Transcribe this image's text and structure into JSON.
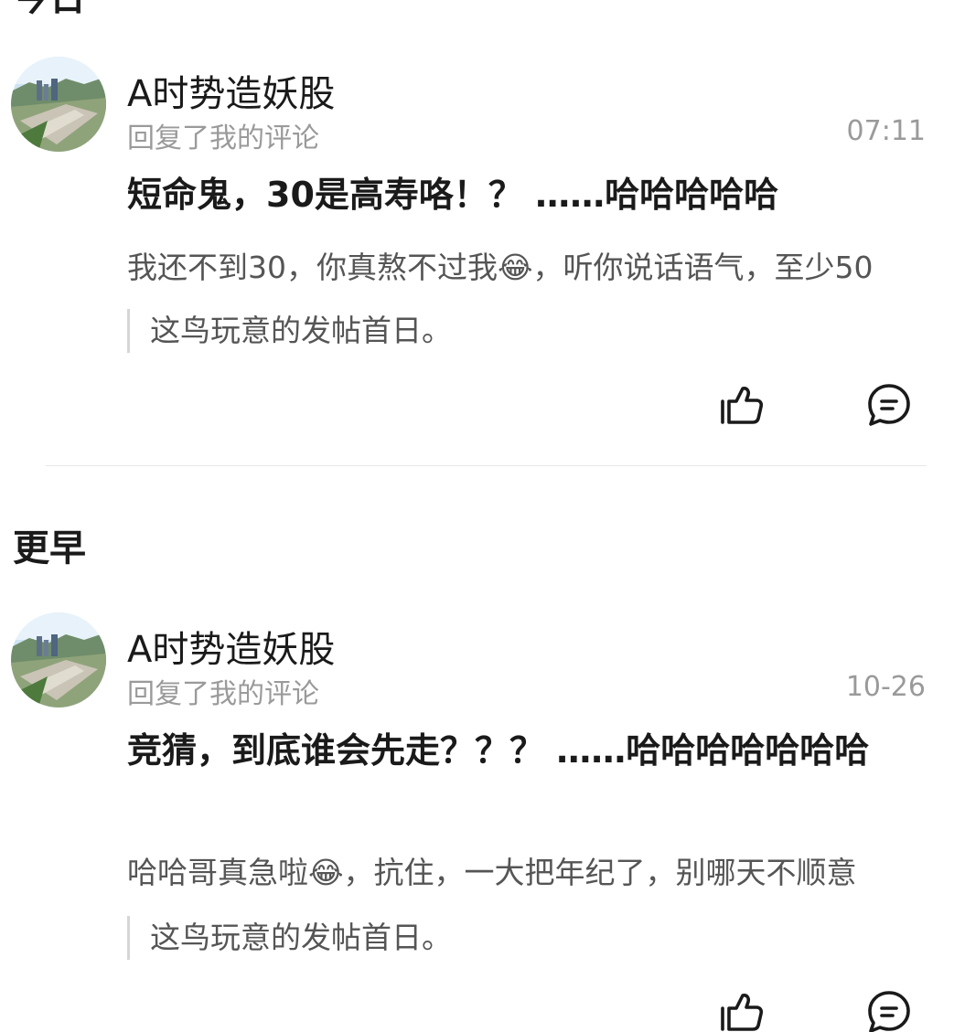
{
  "sections": {
    "today_title": "今日",
    "earlier_title": "更早"
  },
  "notifications": [
    {
      "username": "A时势造妖股",
      "action_text": "回复了我的评论",
      "time": "07:11",
      "reply": "短命鬼，30是高寿咯！？ ……哈哈哈哈哈",
      "quoted_comment": "我还不到30，你真熬不过我😂，听你说话语气，至少50",
      "post_title": "这鸟玩意的发帖首日。"
    },
    {
      "username": "A时势造妖股",
      "action_text": "回复了我的评论",
      "time": "10-26",
      "reply": "竞猜，到底谁会先走？？？ ……哈哈哈哈哈哈哈",
      "quoted_comment": "哈哈哥真急啦😂，抗住，一大把年纪了，别哪天不顺意",
      "post_title": "这鸟玩意的发帖首日。"
    }
  ],
  "icons": {
    "like": "thumbs-up-icon",
    "comment": "comment-bubble-icon"
  },
  "colors": {
    "primary_text": "#1a1a1a",
    "secondary_text": "#9a9a9a",
    "quote_text": "#555555",
    "quote_bar": "#d6d6d6",
    "divider": "#e6e6e6"
  }
}
